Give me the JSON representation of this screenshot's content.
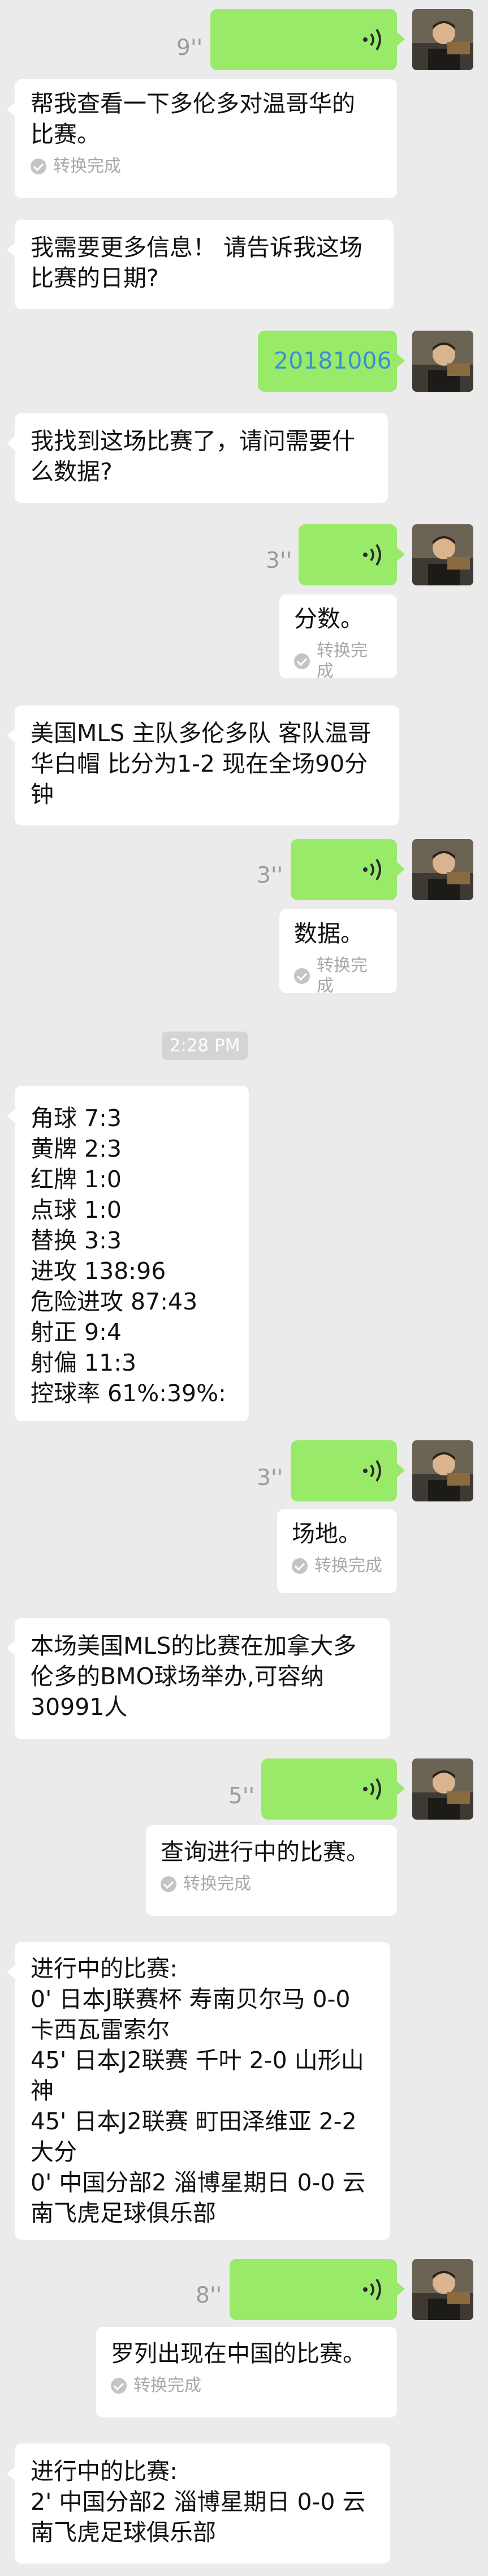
{
  "conversation": {
    "voice_durations": [
      "9''",
      "3''",
      "3''",
      "3''",
      "5''",
      "8''"
    ],
    "transcript_status": "转换完成",
    "timestamp": "2:28 PM",
    "messages": {
      "m1": "帮我查看一下多伦多对温哥华的|比赛。",
      "m2": "我需要更多信息！ 请告诉我这场|比赛的日期?",
      "m3": "20181006",
      "m4": "我找到这场比赛了，请问需要什|么数据?",
      "m5": "分数。",
      "m6": "美国MLS 主队多伦多队 客队温哥|华白帽 比分为1-2 现在全场90分|钟",
      "m7": "数据。",
      "m8": "角球 7:3|黄牌 2:3|红牌 1:0|点球 1:0|替换 3:3|进攻 138:96|危险进攻 87:43|射正 9:4|射偏 11:3|控球率 61%:39%:",
      "m9": "场地。",
      "m10": "本场美国MLS的比赛在加拿大多|伦多的BMO球场举办,可容纳|30991人",
      "m11": "查询进行中的比赛。",
      "m12": "进行中的比赛:|0' 日本J联赛杯 寿南贝尔马 0-0|卡西瓦雷索尔|45' 日本J2联赛 千叶 2-0 山形山|神|45' 日本J2联赛 町田泽维亚 2-2|大分|0' 中国分部2 淄博星期日 0-0 云|南飞虎足球俱乐部",
      "m13": "罗列出现在中国的比赛。",
      "m14": "进行中的比赛:|2' 中国分部2 淄博星期日 0-0 云|南飞虎足球俱乐部"
    }
  },
  "colors": {
    "background": "#ebebeb",
    "outgoing_bubble": "#9aea6a",
    "incoming_bubble": "#ffffff",
    "link_text": "#3a8fd8"
  },
  "icons": [
    "voice-wave-icon",
    "check-circle-icon",
    "user-avatar"
  ]
}
